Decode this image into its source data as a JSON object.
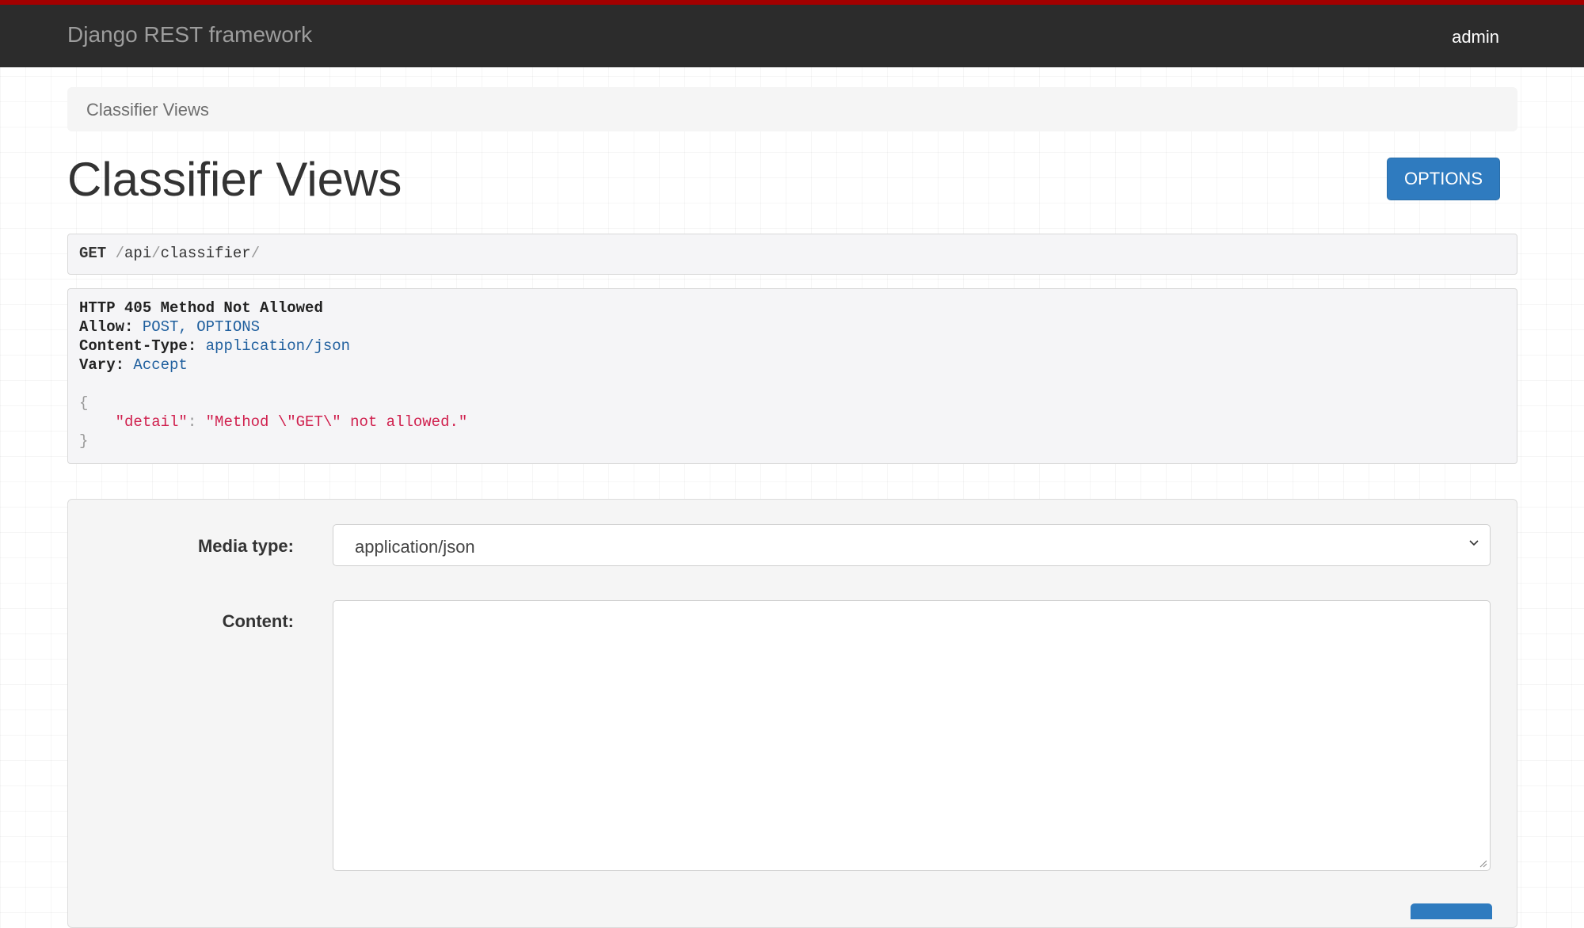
{
  "navbar": {
    "brand": "Django REST framework",
    "user": "admin"
  },
  "breadcrumb": {
    "items": [
      "Classifier Views"
    ]
  },
  "page": {
    "title": "Classifier Views",
    "options_button": "OPTIONS"
  },
  "request": {
    "method": "GET",
    "path_parts": [
      "api",
      "classifier"
    ]
  },
  "response": {
    "status_line": "HTTP 405 Method Not Allowed",
    "headers": [
      {
        "name": "Allow:",
        "value": "POST, OPTIONS"
      },
      {
        "name": "Content-Type:",
        "value": "application/json"
      },
      {
        "name": "Vary:",
        "value": "Accept"
      }
    ],
    "body_key": "\"detail\"",
    "body_value": "\"Method \\\"GET\\\" not allowed.\""
  },
  "form": {
    "media_type_label": "Media type:",
    "media_type_value": "application/json",
    "content_label": "Content:",
    "content_value": ""
  },
  "colors": {
    "navbar_bg": "#2c2c2c",
    "top_accent": "#a30000",
    "primary_button": "#2f7bbf",
    "json_string": "#d0204e",
    "header_value": "#1f5f9e"
  }
}
